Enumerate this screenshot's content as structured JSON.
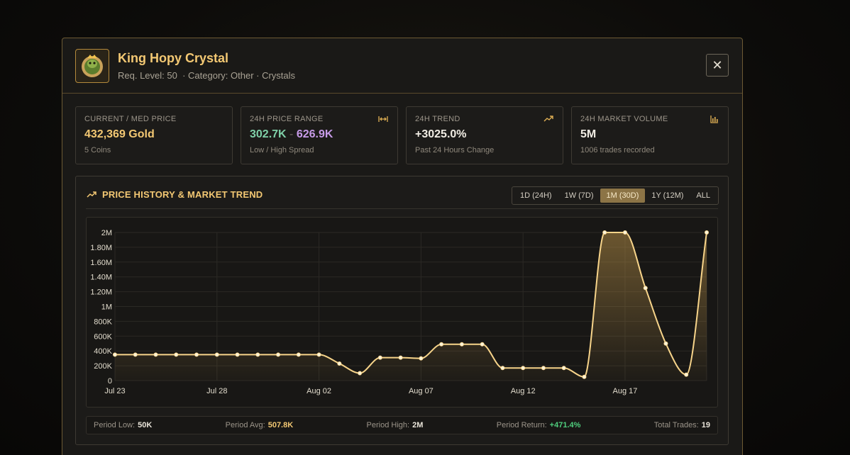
{
  "item": {
    "name": "King Hopy Crystal",
    "req_level_label": "Req. Level:",
    "req_level": "50",
    "category_text": "· Category: Other · Crystals"
  },
  "close_label": "✕",
  "cards": {
    "price": {
      "label": "CURRENT / MED PRICE",
      "value": "432,369 Gold",
      "sub": "5 Coins"
    },
    "range": {
      "label": "24H PRICE RANGE",
      "low": "302.7K",
      "sep": "-",
      "high": "626.9K",
      "sub": "Low / High Spread",
      "icon": "range-icon"
    },
    "trend": {
      "label": "24H TREND",
      "value": "+3025.0%",
      "sub": "Past 24 Hours Change",
      "icon": "trend-icon"
    },
    "volume": {
      "label": "24H MARKET VOLUME",
      "value": "5M",
      "sub": "1006 trades recorded",
      "icon": "bar-chart-icon"
    }
  },
  "chart_panel": {
    "title": "PRICE HISTORY & MARKET TREND",
    "tabs": [
      "1D (24H)",
      "1W (7D)",
      "1M (30D)",
      "1Y (12M)",
      "ALL"
    ],
    "active_tab": "1M (30D)"
  },
  "footer": {
    "low_label": "Period Low:",
    "low": "50K",
    "avg_label": "Period Avg:",
    "avg": "507.8K",
    "high_label": "Period High:",
    "high": "2M",
    "return_label": "Period Return:",
    "return": "+471.4%",
    "trades_label": "Total Trades:",
    "trades": "19"
  },
  "colors": {
    "accent": "#f3c873",
    "line": "#f7d48a",
    "positive": "#4fce7d"
  },
  "chart_data": {
    "type": "area",
    "x_tick_labels": [
      "Jul 23",
      "Jul 28",
      "Aug 02",
      "Aug 07",
      "Aug 12",
      "Aug 17"
    ],
    "y_tick_labels": [
      "0",
      "200K",
      "400K",
      "600K",
      "800K",
      "1M",
      "1.20M",
      "1.40M",
      "1.60M",
      "1.80M",
      "2M"
    ],
    "ylim": [
      0,
      2000000
    ],
    "x_days": [
      0,
      1,
      2,
      3,
      4,
      5,
      6,
      7,
      8,
      9,
      10,
      11,
      12,
      13,
      14,
      15,
      16,
      17,
      18,
      19,
      20,
      21,
      22,
      23,
      24,
      25,
      26,
      27,
      28,
      29
    ],
    "values": [
      350000,
      350000,
      350000,
      350000,
      350000,
      350000,
      350000,
      350000,
      350000,
      350000,
      350000,
      230000,
      100000,
      310000,
      310000,
      300000,
      490000,
      490000,
      490000,
      170000,
      170000,
      170000,
      170000,
      50000,
      2000000,
      2000000,
      1250000,
      500000,
      80000,
      2000000
    ],
    "grid": true
  }
}
